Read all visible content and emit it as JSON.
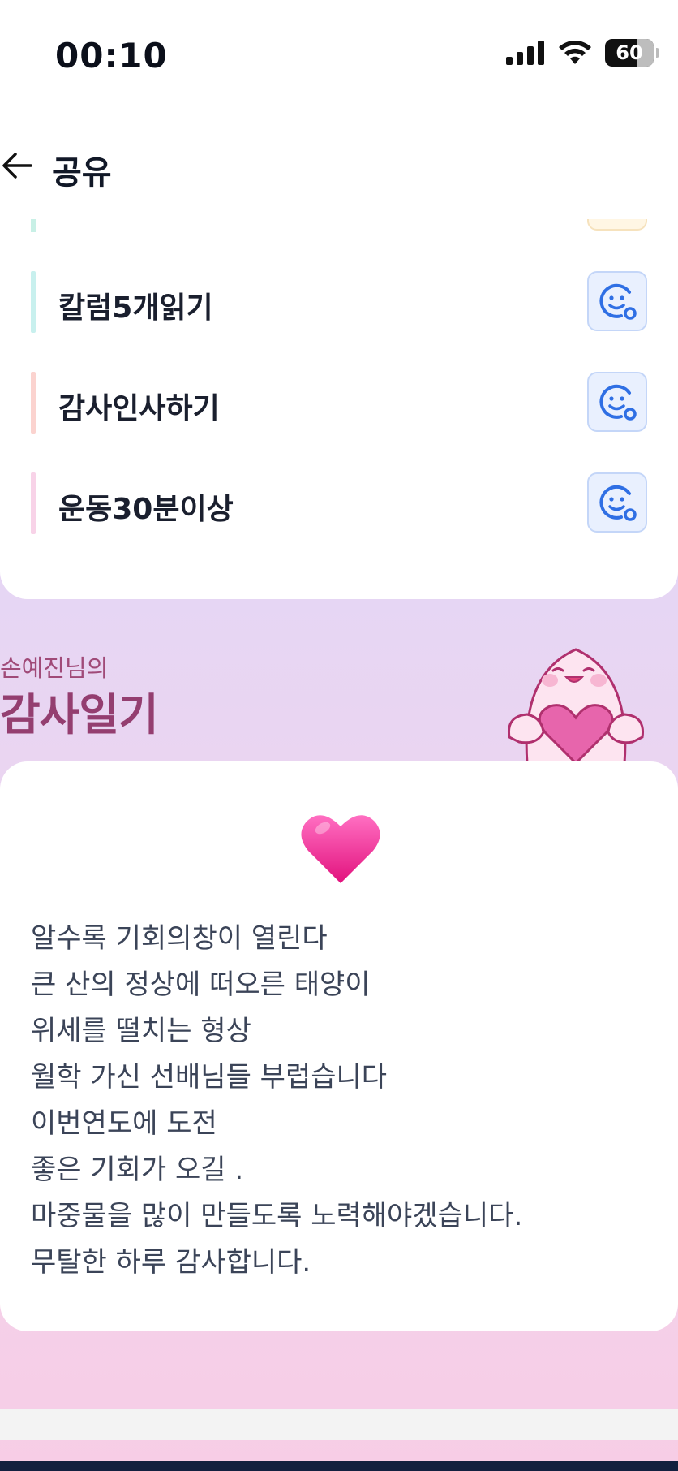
{
  "status_bar": {
    "time": "00:10",
    "battery": "60"
  },
  "header": {
    "title": "공유"
  },
  "habits": [
    {
      "label": "칼럼5개읽기",
      "bar_color": "#c8f0ee"
    },
    {
      "label": "감사인사하기",
      "bar_color": "#fbd3cf"
    },
    {
      "label": "운동30분이상",
      "bar_color": "#f8d3e8"
    }
  ],
  "diary": {
    "owner": "손예진님의",
    "title": "감사일기",
    "emoji": "heart",
    "lines": [
      "알수록 기회의창이 열린다",
      "큰 산의 정상에 떠오른 태양이",
      "위세를 떨치는 형상",
      "월학 가신 선배님들 부럽습니다",
      "이번연도에 도전",
      "좋은 기회가 오길 .",
      "마중물을 많이 만들도록 노력해야겠습니다.",
      "무탈한 하루 감사합니다."
    ]
  }
}
